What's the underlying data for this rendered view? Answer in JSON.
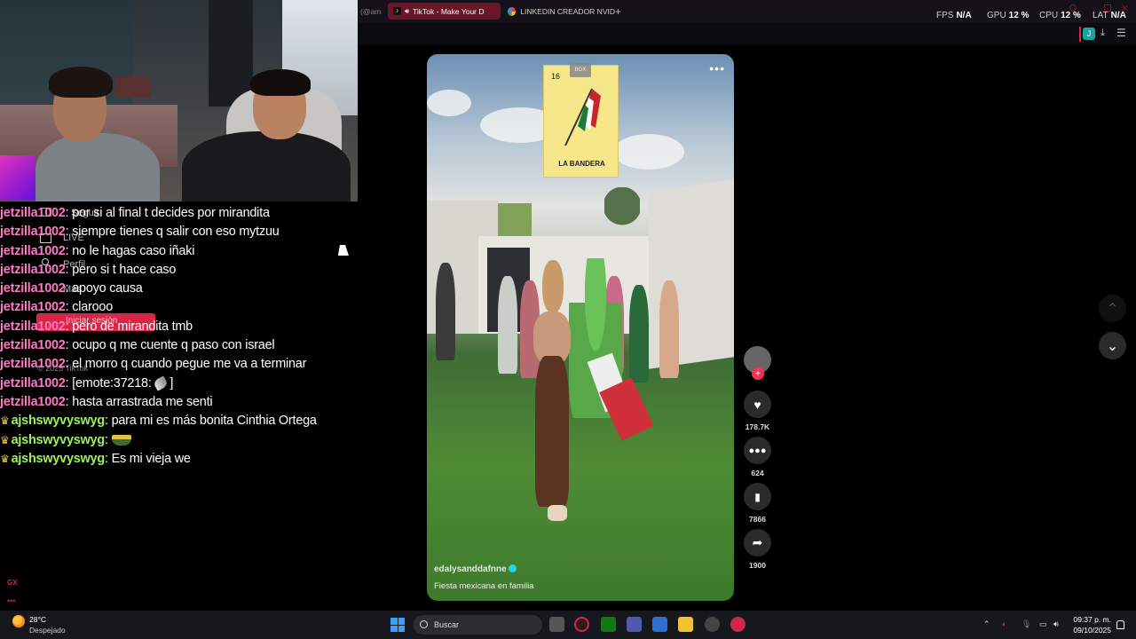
{
  "browser": {
    "tabs": [
      {
        "label": "(@am",
        "partial": true
      },
      {
        "label": "TikTok - Make Your D",
        "active": true,
        "icon": "tiktok-icon",
        "audio": true
      },
      {
        "label": "LINKEDIN CREADOR NVID",
        "icon": "google-icon"
      }
    ],
    "new_tab": "+",
    "stats": {
      "fps_label": "FPS",
      "fps_value": "N/A",
      "gpu_label": "GPU",
      "gpu_value": "12 %",
      "cpu_label": "CPU",
      "cpu_value": "12 %",
      "lat_label": "LAT",
      "lat_value": "N/A"
    },
    "extension_letter": "J",
    "accent_color": "#e0244c"
  },
  "chat": {
    "messages": [
      {
        "user": "jetzilla1002",
        "color": "#ff78c4",
        "text": ": por si al final t decides por mirandita"
      },
      {
        "user": "jetzilla1002",
        "color": "#ff78c4",
        "text": ": siempre tienes q salir con eso mytzuu"
      },
      {
        "user": "jetzilla1002",
        "color": "#ff78c4",
        "text": ": no le hagas caso iñaki"
      },
      {
        "user": "jetzilla1002",
        "color": "#ff78c4",
        "text": ": pero si t hace caso"
      },
      {
        "user": "jetzilla1002",
        "color": "#ff78c4",
        "text": ": apoyo causa"
      },
      {
        "user": "jetzilla1002",
        "color": "#ff78c4",
        "text": ": clarooo"
      },
      {
        "user": "jetzilla1002",
        "color": "#ff78c4",
        "text": ": pero de mirandita tmb"
      },
      {
        "user": "jetzilla1002",
        "color": "#ff78c4",
        "text": ": ocupo q me cuente q paso con israel"
      },
      {
        "user": "jetzilla1002",
        "color": "#ff78c4",
        "text": ": el morro q cuando pegue me va a terminar"
      },
      {
        "user": "jetzilla1002",
        "color": "#ff78c4",
        "text": ": [emote:37218:",
        "suffix": " ]",
        "emote": "feather"
      },
      {
        "user": "jetzilla1002",
        "color": "#ff78c4",
        "text": ": hasta arrastrada me senti"
      },
      {
        "user": "ajshswyvyswyg",
        "color": "#9cf25c",
        "crown": true,
        "text": ": para mi es más bonita Cinthia Ortega"
      },
      {
        "user": "ajshswyvyswyg",
        "color": "#9cf25c",
        "crown": true,
        "text": ":",
        "emote": "boat"
      },
      {
        "user": "ajshswyvyswyg",
        "color": "#9cf25c",
        "crown": true,
        "text": ": Es mi vieja we"
      }
    ]
  },
  "ghost_sidebar": {
    "following": "Seguir",
    "live": "LIVE",
    "profile": "Perfil",
    "more": "Más",
    "login": "Iniciar sesión",
    "copyright": "© 2025 TikTok"
  },
  "video": {
    "card_number": "16",
    "card_title": "LA BANDERA",
    "watermark": "BGX",
    "username": "edalysanddafnne",
    "description": "Fiesta mexicana en familia",
    "more": "•••"
  },
  "actions": {
    "likes": "178.7K",
    "comments": "624",
    "saves": "7866",
    "shares": "1900"
  },
  "taskbar": {
    "temperature": "28°C",
    "weather": "Despejado",
    "search_placeholder": "Buscar",
    "time": "09:37 p. m.",
    "date": "09/10/2025",
    "gx_label": "GX"
  }
}
